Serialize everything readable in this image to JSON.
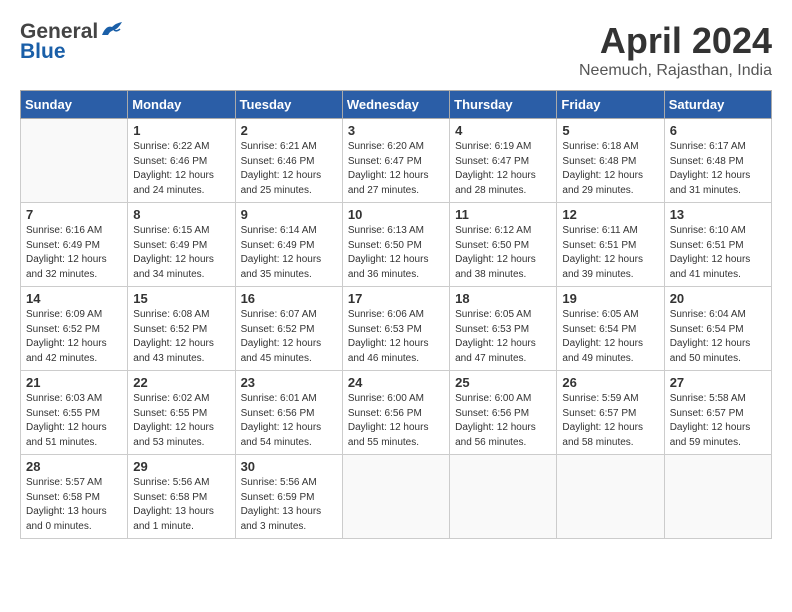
{
  "header": {
    "logo_general": "General",
    "logo_blue": "Blue",
    "title": "April 2024",
    "subtitle": "Neemuch, Rajasthan, India"
  },
  "columns": [
    "Sunday",
    "Monday",
    "Tuesday",
    "Wednesday",
    "Thursday",
    "Friday",
    "Saturday"
  ],
  "weeks": [
    [
      {
        "day": "",
        "info": ""
      },
      {
        "day": "1",
        "info": "Sunrise: 6:22 AM\nSunset: 6:46 PM\nDaylight: 12 hours\nand 24 minutes."
      },
      {
        "day": "2",
        "info": "Sunrise: 6:21 AM\nSunset: 6:46 PM\nDaylight: 12 hours\nand 25 minutes."
      },
      {
        "day": "3",
        "info": "Sunrise: 6:20 AM\nSunset: 6:47 PM\nDaylight: 12 hours\nand 27 minutes."
      },
      {
        "day": "4",
        "info": "Sunrise: 6:19 AM\nSunset: 6:47 PM\nDaylight: 12 hours\nand 28 minutes."
      },
      {
        "day": "5",
        "info": "Sunrise: 6:18 AM\nSunset: 6:48 PM\nDaylight: 12 hours\nand 29 minutes."
      },
      {
        "day": "6",
        "info": "Sunrise: 6:17 AM\nSunset: 6:48 PM\nDaylight: 12 hours\nand 31 minutes."
      }
    ],
    [
      {
        "day": "7",
        "info": "Sunrise: 6:16 AM\nSunset: 6:49 PM\nDaylight: 12 hours\nand 32 minutes."
      },
      {
        "day": "8",
        "info": "Sunrise: 6:15 AM\nSunset: 6:49 PM\nDaylight: 12 hours\nand 34 minutes."
      },
      {
        "day": "9",
        "info": "Sunrise: 6:14 AM\nSunset: 6:49 PM\nDaylight: 12 hours\nand 35 minutes."
      },
      {
        "day": "10",
        "info": "Sunrise: 6:13 AM\nSunset: 6:50 PM\nDaylight: 12 hours\nand 36 minutes."
      },
      {
        "day": "11",
        "info": "Sunrise: 6:12 AM\nSunset: 6:50 PM\nDaylight: 12 hours\nand 38 minutes."
      },
      {
        "day": "12",
        "info": "Sunrise: 6:11 AM\nSunset: 6:51 PM\nDaylight: 12 hours\nand 39 minutes."
      },
      {
        "day": "13",
        "info": "Sunrise: 6:10 AM\nSunset: 6:51 PM\nDaylight: 12 hours\nand 41 minutes."
      }
    ],
    [
      {
        "day": "14",
        "info": "Sunrise: 6:09 AM\nSunset: 6:52 PM\nDaylight: 12 hours\nand 42 minutes."
      },
      {
        "day": "15",
        "info": "Sunrise: 6:08 AM\nSunset: 6:52 PM\nDaylight: 12 hours\nand 43 minutes."
      },
      {
        "day": "16",
        "info": "Sunrise: 6:07 AM\nSunset: 6:52 PM\nDaylight: 12 hours\nand 45 minutes."
      },
      {
        "day": "17",
        "info": "Sunrise: 6:06 AM\nSunset: 6:53 PM\nDaylight: 12 hours\nand 46 minutes."
      },
      {
        "day": "18",
        "info": "Sunrise: 6:05 AM\nSunset: 6:53 PM\nDaylight: 12 hours\nand 47 minutes."
      },
      {
        "day": "19",
        "info": "Sunrise: 6:05 AM\nSunset: 6:54 PM\nDaylight: 12 hours\nand 49 minutes."
      },
      {
        "day": "20",
        "info": "Sunrise: 6:04 AM\nSunset: 6:54 PM\nDaylight: 12 hours\nand 50 minutes."
      }
    ],
    [
      {
        "day": "21",
        "info": "Sunrise: 6:03 AM\nSunset: 6:55 PM\nDaylight: 12 hours\nand 51 minutes."
      },
      {
        "day": "22",
        "info": "Sunrise: 6:02 AM\nSunset: 6:55 PM\nDaylight: 12 hours\nand 53 minutes."
      },
      {
        "day": "23",
        "info": "Sunrise: 6:01 AM\nSunset: 6:56 PM\nDaylight: 12 hours\nand 54 minutes."
      },
      {
        "day": "24",
        "info": "Sunrise: 6:00 AM\nSunset: 6:56 PM\nDaylight: 12 hours\nand 55 minutes."
      },
      {
        "day": "25",
        "info": "Sunrise: 6:00 AM\nSunset: 6:56 PM\nDaylight: 12 hours\nand 56 minutes."
      },
      {
        "day": "26",
        "info": "Sunrise: 5:59 AM\nSunset: 6:57 PM\nDaylight: 12 hours\nand 58 minutes."
      },
      {
        "day": "27",
        "info": "Sunrise: 5:58 AM\nSunset: 6:57 PM\nDaylight: 12 hours\nand 59 minutes."
      }
    ],
    [
      {
        "day": "28",
        "info": "Sunrise: 5:57 AM\nSunset: 6:58 PM\nDaylight: 13 hours\nand 0 minutes."
      },
      {
        "day": "29",
        "info": "Sunrise: 5:56 AM\nSunset: 6:58 PM\nDaylight: 13 hours\nand 1 minute."
      },
      {
        "day": "30",
        "info": "Sunrise: 5:56 AM\nSunset: 6:59 PM\nDaylight: 13 hours\nand 3 minutes."
      },
      {
        "day": "",
        "info": ""
      },
      {
        "day": "",
        "info": ""
      },
      {
        "day": "",
        "info": ""
      },
      {
        "day": "",
        "info": ""
      }
    ]
  ]
}
